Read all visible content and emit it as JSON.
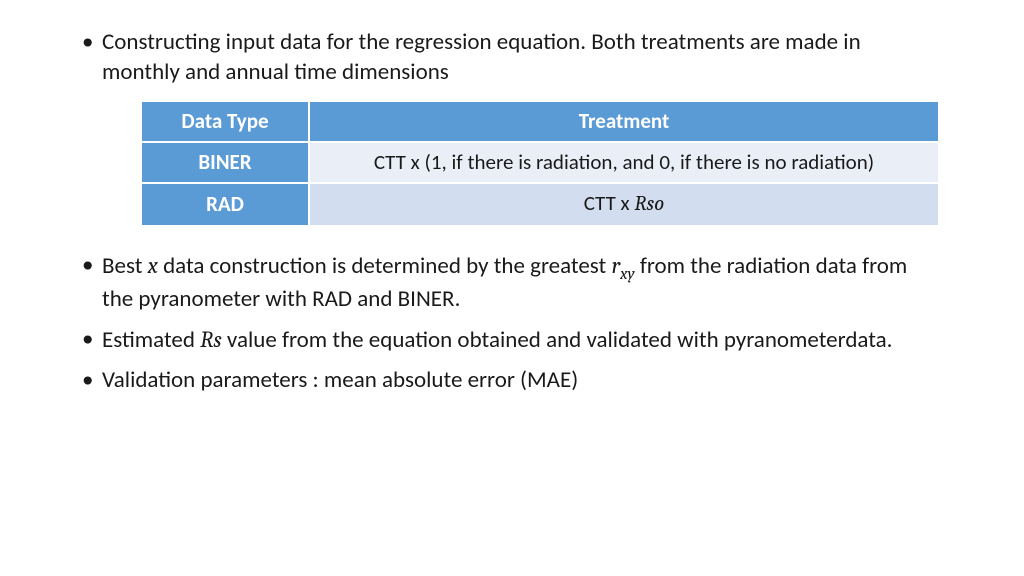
{
  "bullets": {
    "b1": "Constructing input data for the regression equation. Both treatments are made in monthly and annual time dimensions",
    "b2_pre": "Best ",
    "b2_x": "x",
    "b2_mid": " data construction is determined by the greatest ",
    "b2_r": "r",
    "b2_rsub": "xy",
    "b2_post": " from the radiation data from the pyranometer with RAD and BINER.",
    "b3_pre": "Estimated ",
    "b3_rs": "Rs",
    "b3_post": " value from the equation obtained and validated with pyranometerdata.",
    "b4": "Validation parameters : mean absolute error (MAE)"
  },
  "table": {
    "headers": {
      "type": "Data Type",
      "treatment": "Treatment"
    },
    "rows": [
      {
        "type": "BINER",
        "treatment": "CTT x (1, if there is radiation, and 0, if there is no radiation)"
      },
      {
        "type": "RAD",
        "treatment_pre": "CTT x ",
        "treatment_math": "Rso"
      }
    ]
  }
}
